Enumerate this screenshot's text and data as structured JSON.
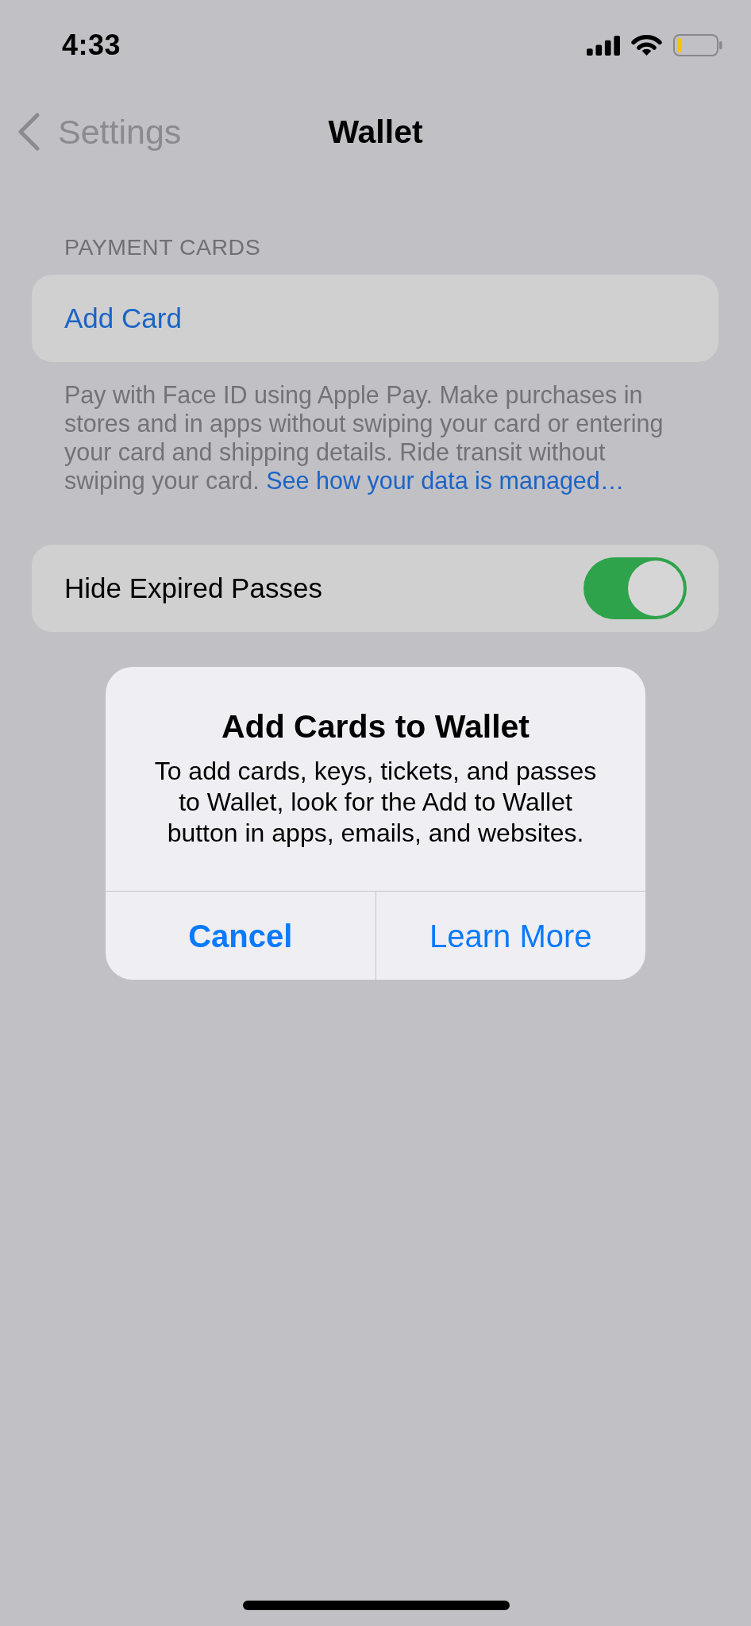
{
  "status_bar": {
    "time": "4:33"
  },
  "nav_bar": {
    "back_label": "Settings",
    "title": "Wallet"
  },
  "payment_cards": {
    "header": "PAYMENT CARDS",
    "add_card": "Add Card",
    "footer": "Pay with Face ID using Apple Pay. Make purchases in stores and in apps without swiping your card or entering your card and shipping details. Ride transit without swiping your card.",
    "footer_link": "See how your data is managed…"
  },
  "settings": [
    {
      "kind": "toggle",
      "label": "Hide Expired Passes",
      "on": true
    }
  ],
  "alert": {
    "title": "Add Cards to Wallet",
    "message": "To add cards, keys, tickets, and passes to Wallet, look for the Add to Wallet button in apps, emails, and websites.",
    "buttons": [
      {
        "kind": "cancel",
        "label": "Cancel"
      },
      {
        "kind": "default",
        "label": "Learn More"
      }
    ]
  }
}
